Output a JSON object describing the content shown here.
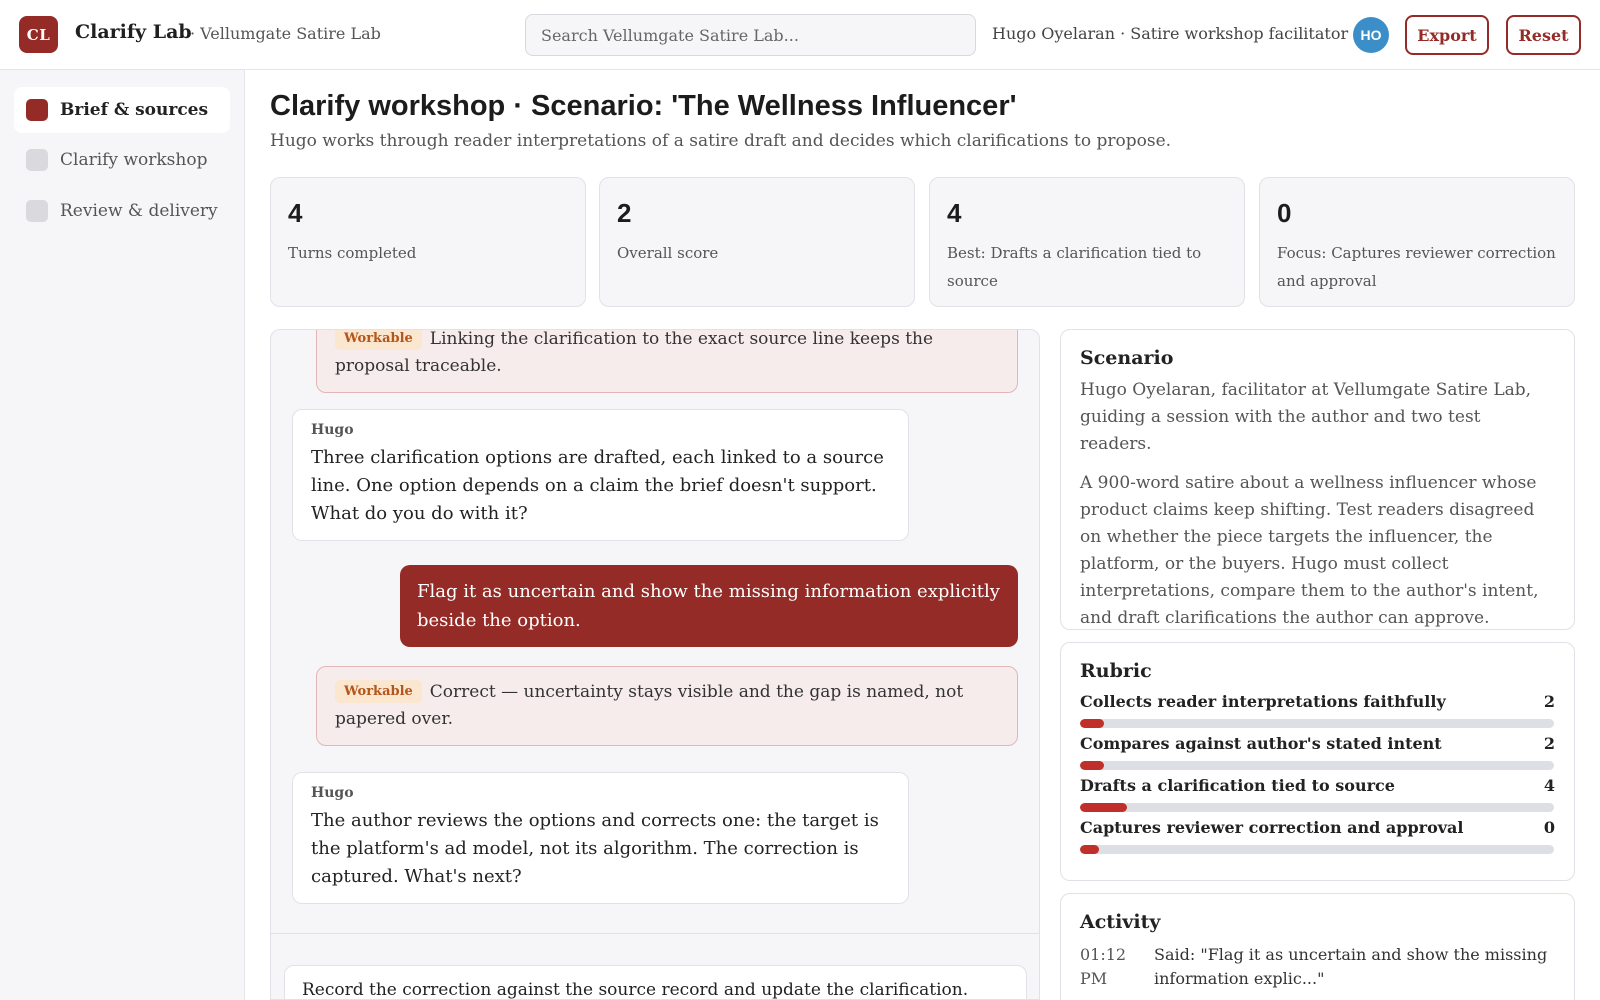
{
  "header": {
    "logo_text": "CL",
    "app_title": "Clarify Lab",
    "org_name": "· Vellumgate Satire Lab",
    "search_placeholder": "Search Vellumgate Satire Lab...",
    "user_name": "Hugo Oyelaran · Satire workshop facilitator",
    "avatar_initials": "HO",
    "export_label": "Export",
    "reset_label": "Reset"
  },
  "sidebar": {
    "items": [
      {
        "label": "Brief & sources",
        "active": true
      },
      {
        "label": "Clarify workshop",
        "active": false
      },
      {
        "label": "Review & delivery",
        "active": false
      }
    ]
  },
  "main": {
    "title": "Clarify workshop · Scenario: 'The Wellness Influencer'",
    "subtitle": "Hugo works through reader interpretations of a satire draft and decides which clarifications to propose."
  },
  "stats": [
    {
      "value": "4",
      "label": "Turns completed"
    },
    {
      "value": "2",
      "label": "Overall score"
    },
    {
      "value": "4",
      "label": "Best: Drafts a clarification tied to source"
    },
    {
      "value": "0",
      "label": "Focus: Captures reviewer correction and approval"
    }
  ],
  "chat": {
    "messages": [
      {
        "type": "feedback",
        "tag": "Workable",
        "text": "Linking the clarification to the exact source line keeps the proposal traceable."
      },
      {
        "type": "bot",
        "author": "Hugo",
        "text": "Three clarification options are drafted, each linked to a source line. One option depends on a claim the brief doesn't support. What do you do with it?"
      },
      {
        "type": "user",
        "text": "Flag it as uncertain and show the missing information explicitly beside the option."
      },
      {
        "type": "feedback",
        "tag": "Workable",
        "text": "Correct — uncertainty stays visible and the gap is named, not papered over."
      },
      {
        "type": "bot",
        "author": "Hugo",
        "text": "The author reviews the options and corrects one: the target is the platform's ad model, not its algorithm. The correction is captured. What's next?"
      }
    ],
    "composer_value": "Record the correction against the source record and update the clarification."
  },
  "scenario": {
    "title": "Scenario",
    "intro": "Hugo Oyelaran, facilitator at Vellumgate Satire Lab, guiding a session with the author and two test readers.",
    "body": "A 900-word satire about a wellness influencer whose product claims keep shifting. Test readers disagreed on whether the piece targets the influencer, the platform, or the buyers. Hugo must collect interpretations, compare them to the author's intent, and draft clarifications the author can approve."
  },
  "rubric": {
    "title": "Rubric",
    "items": [
      {
        "label": "Collects reader interpretations faithfully",
        "score": "2",
        "fill": 0.05
      },
      {
        "label": "Compares against author's stated intent",
        "score": "2",
        "fill": 0.05
      },
      {
        "label": "Drafts a clarification tied to source",
        "score": "4",
        "fill": 0.1
      },
      {
        "label": "Captures reviewer correction and approval",
        "score": "0",
        "fill": 0.04
      }
    ]
  },
  "activity": {
    "title": "Activity",
    "items": [
      {
        "time": "01:12 PM",
        "text": "Said: \"Flag it as uncertain and show the missing information explic...\""
      }
    ]
  },
  "colors": {
    "brand": "#942b26",
    "avatar": "#3c8ec9",
    "tag_bg": "#fbe7cf",
    "tag_text": "#b4551b",
    "rubric_fill": "#c02f2a"
  }
}
